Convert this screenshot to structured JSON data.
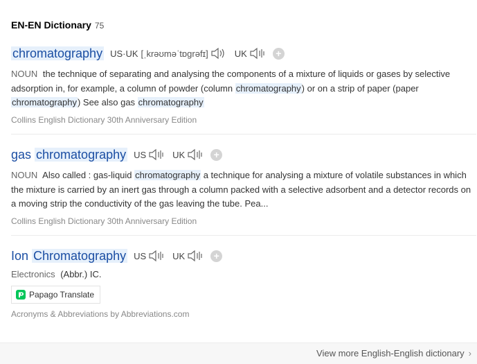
{
  "header": {
    "title": "EN-EN Dictionary",
    "count": "75"
  },
  "entries": [
    {
      "word": "chromatography",
      "pron_label": "US·UK",
      "phonetic": "[ˌkrəʊməˈtɒɡrəfɪ]",
      "uk_label": "UK",
      "pos": "NOUN",
      "def_parts": [
        " the technique of separating and analysing the components of a mixture of liquids or gases by selective adsorption in, for example, a column of powder (column ",
        "chromatography",
        ") or on a strip of paper (paper ",
        "chromatography",
        ") See also gas ",
        "chromatography"
      ],
      "source": "Collins English Dictionary 30th Anniversary Edition"
    },
    {
      "word_prefix": "gas ",
      "word": "chromatography",
      "us_label": "US",
      "uk_label": "UK",
      "pos": "NOUN",
      "def_parts": [
        " Also called : gas-liquid ",
        "chromatography",
        " a technique for analysing a mixture of volatile substances in which the mixture is carried by an inert gas through a column packed with a selective adsorbent and a detector records on a moving strip the conductivity of the gas leaving the tube. Pea..."
      ],
      "source": "Collins English Dictionary 30th Anniversary Edition"
    },
    {
      "word_prefix": "Ion ",
      "word": "Chromatography",
      "us_label": "US",
      "uk_label": "UK",
      "category": "Electronics",
      "abbr": "(Abbr.) IC.",
      "papago_label": "Papago Translate",
      "source": "Acronyms & Abbreviations by Abbreviations.com"
    }
  ],
  "footer": {
    "link": "View more English-English dictionary"
  },
  "colors": {
    "accent": "#1b4ea3",
    "highlight": "#e6f0fb",
    "papago_green": "#03c75a"
  }
}
